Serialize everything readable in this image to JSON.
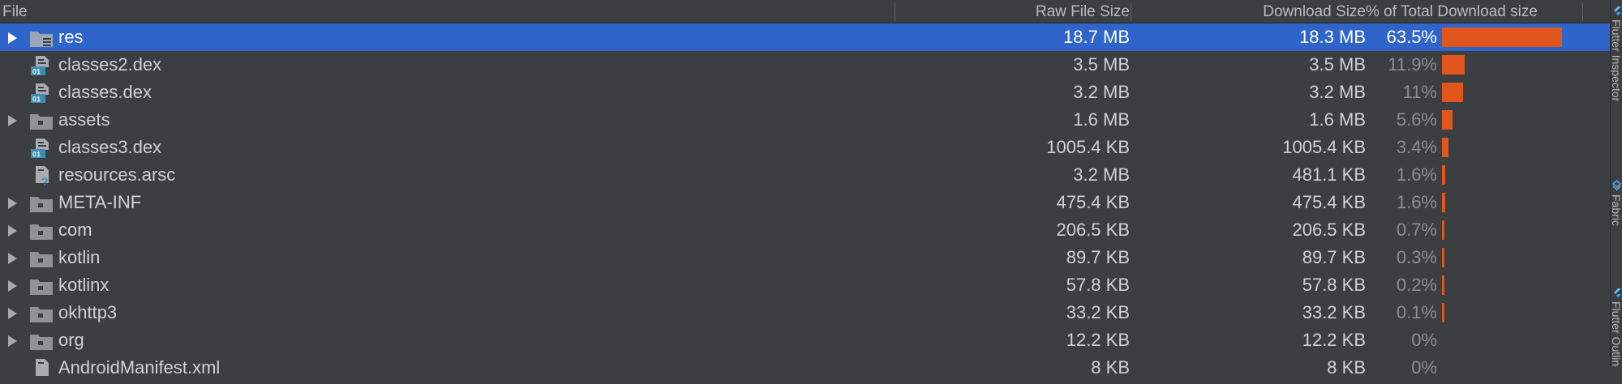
{
  "header": {
    "file": "File",
    "raw_size": "Raw File Size",
    "download_size": "Download Size",
    "pct_total": "% of Total Download size"
  },
  "rows": [
    {
      "name": "res",
      "raw": "18.7 MB",
      "download": "18.3 MB",
      "pct": "63.5%",
      "share": 0.635,
      "icon": "resource-folder-icon",
      "expandable": true,
      "selected": true
    },
    {
      "name": "classes2.dex",
      "raw": "3.5 MB",
      "download": "3.5 MB",
      "pct": "11.9%",
      "share": 0.119,
      "icon": "dex-file-icon",
      "expandable": false,
      "selected": false
    },
    {
      "name": "classes.dex",
      "raw": "3.2 MB",
      "download": "3.2 MB",
      "pct": "11%",
      "share": 0.11,
      "icon": "dex-file-icon",
      "expandable": false,
      "selected": false
    },
    {
      "name": "assets",
      "raw": "1.6 MB",
      "download": "1.6 MB",
      "pct": "5.6%",
      "share": 0.056,
      "icon": "folder-icon",
      "expandable": true,
      "selected": false
    },
    {
      "name": "classes3.dex",
      "raw": "1005.4 KB",
      "download": "1005.4 KB",
      "pct": "3.4%",
      "share": 0.034,
      "icon": "dex-file-icon",
      "expandable": false,
      "selected": false
    },
    {
      "name": "resources.arsc",
      "raw": "3.2 MB",
      "download": "481.1 KB",
      "pct": "1.6%",
      "share": 0.016,
      "icon": "unknown-file-icon",
      "expandable": false,
      "selected": false
    },
    {
      "name": "META-INF",
      "raw": "475.4 KB",
      "download": "475.4 KB",
      "pct": "1.6%",
      "share": 0.016,
      "icon": "folder-icon",
      "expandable": true,
      "selected": false
    },
    {
      "name": "com",
      "raw": "206.5 KB",
      "download": "206.5 KB",
      "pct": "0.7%",
      "share": 0.007,
      "icon": "folder-icon",
      "expandable": true,
      "selected": false
    },
    {
      "name": "kotlin",
      "raw": "89.7 KB",
      "download": "89.7 KB",
      "pct": "0.3%",
      "share": 0.003,
      "icon": "folder-icon",
      "expandable": true,
      "selected": false
    },
    {
      "name": "kotlinx",
      "raw": "57.8 KB",
      "download": "57.8 KB",
      "pct": "0.2%",
      "share": 0.002,
      "icon": "folder-icon",
      "expandable": true,
      "selected": false
    },
    {
      "name": "okhttp3",
      "raw": "33.2 KB",
      "download": "33.2 KB",
      "pct": "0.1%",
      "share": 0.001,
      "icon": "folder-icon",
      "expandable": true,
      "selected": false
    },
    {
      "name": "org",
      "raw": "12.2 KB",
      "download": "12.2 KB",
      "pct": "0%",
      "share": 0.0,
      "icon": "folder-icon",
      "expandable": true,
      "selected": false
    },
    {
      "name": "AndroidManifest.xml",
      "raw": "8 KB",
      "download": "8 KB",
      "pct": "0%",
      "share": 0.0,
      "icon": "xml-file-icon",
      "expandable": false,
      "selected": false
    }
  ],
  "side_panel": {
    "tabs": [
      "Flutter Inspector",
      "Fabric",
      "Flutter Outline"
    ]
  },
  "colors": {
    "background": "#3c3f41",
    "selection": "#2f65ca",
    "bar": "#e0561c",
    "dex_icon": "#3d8cb3"
  }
}
